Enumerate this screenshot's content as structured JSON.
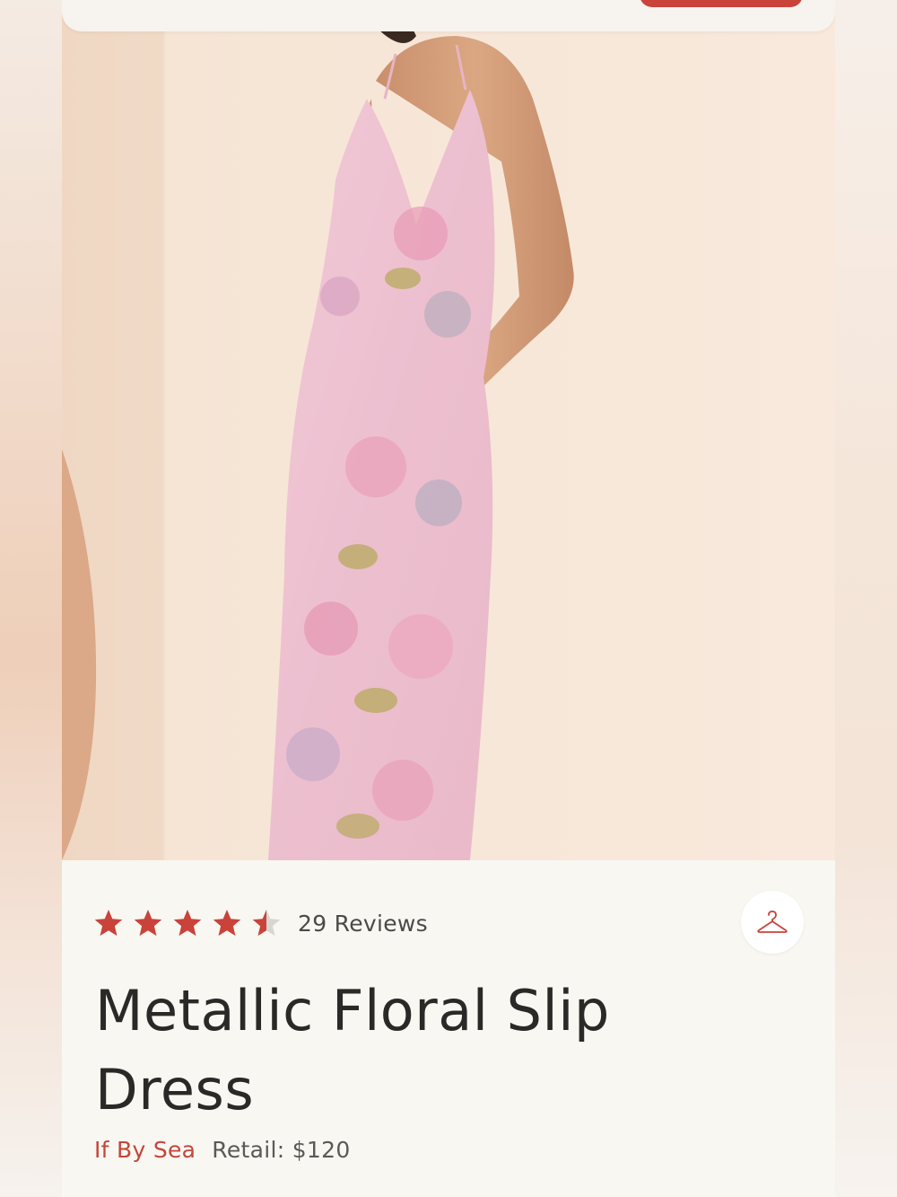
{
  "product": {
    "rating": 4.5,
    "rating_max": 5,
    "reviews_label": "29 Reviews",
    "title": "Metallic Floral Slip Dress",
    "brand": "If By Sea",
    "retail_label": "Retail: $120"
  },
  "icons": {
    "hanger": "hanger-icon",
    "star": "star-icon"
  },
  "colors": {
    "accent": "#c9433a",
    "star": "#c9433a",
    "star_empty": "#d9d6d0",
    "text": "#2a2927",
    "background": "#f8f7f2"
  }
}
